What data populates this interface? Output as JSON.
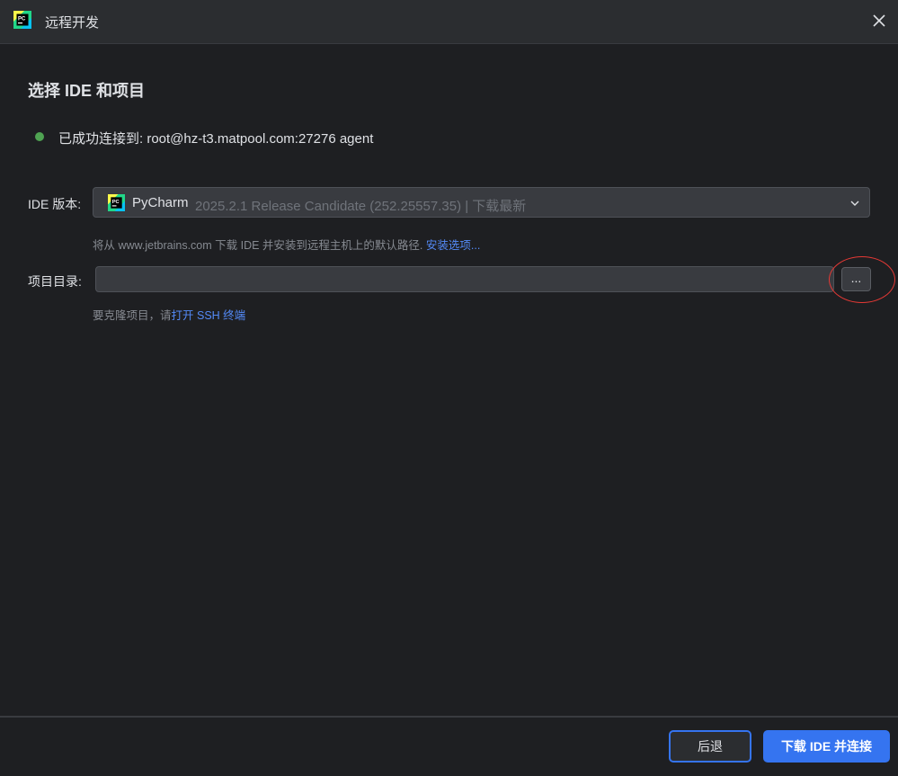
{
  "window": {
    "title": "远程开发",
    "app_icon": "pycharm-logo",
    "close_icon": "close-icon"
  },
  "heading": "选择 IDE 和项目",
  "status": {
    "text": "已成功连接到: root@hz-t3.matpool.com:27276 agent",
    "color": "#4fa352"
  },
  "ide": {
    "label": "IDE 版本:",
    "name": "PyCharm",
    "version": "2025.2.1 Release Candidate (252.25557.35) | 下载最新",
    "hint_text": "将从 www.jetbrains.com 下载 IDE 并安装到远程主机上的默认路径.",
    "hint_link": "安装选项..."
  },
  "project": {
    "label": "项目目录:",
    "value": "",
    "browse_label": "...",
    "hint_text": "要克隆项目，请",
    "hint_link": "打开 SSH 终端"
  },
  "footer": {
    "back_label": "后退",
    "primary_label": "下载 IDE 并连接"
  },
  "colors": {
    "accent": "#3574f0",
    "link": "#548af7",
    "annotation": "#e53935"
  }
}
